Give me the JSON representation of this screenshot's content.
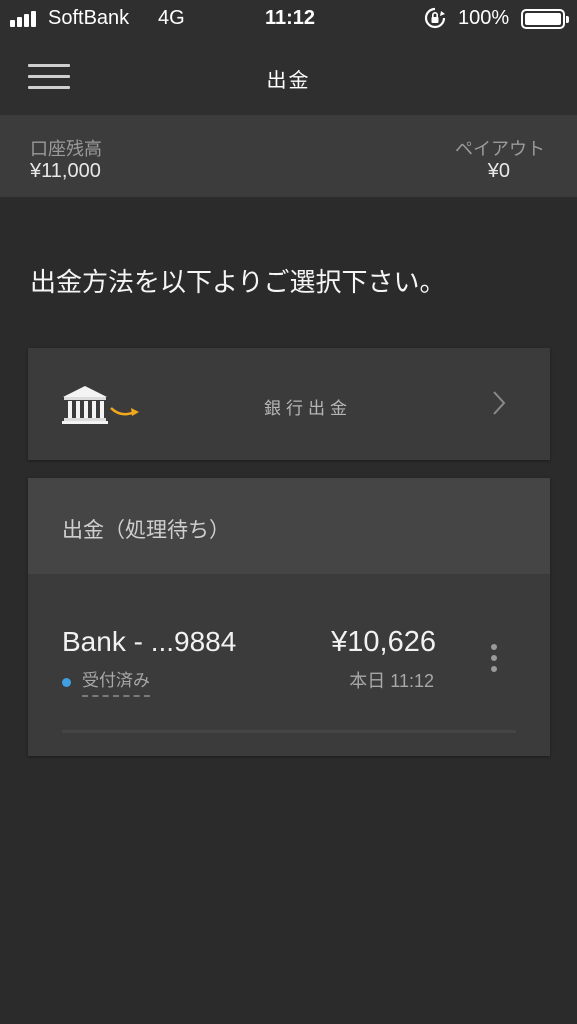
{
  "status_bar": {
    "carrier": "SoftBank",
    "network": "4G",
    "time": "11:12",
    "battery": "100%",
    "icons": [
      "signal-icon",
      "rotation-lock-icon",
      "battery-icon"
    ]
  },
  "header": {
    "title": "出金",
    "menu_icon": "hamburger-icon"
  },
  "balance": {
    "account_label": "口座残高",
    "account_value": "¥11,000",
    "payout_label": "ペイアウト",
    "payout_value": "¥0"
  },
  "instruction": "出金方法を以下よりご選択下さい。",
  "withdrawal_methods": [
    {
      "label": "銀行出金",
      "icon": "bank-icon"
    }
  ],
  "pending": {
    "title": "出金（処理待ち）",
    "items": [
      {
        "account": "Bank - ...9884",
        "amount": "¥10,626",
        "status": "受付済み",
        "time": "本日 11:12"
      }
    ]
  },
  "colors": {
    "background": "#2b2b2b",
    "card": "#3b3b3b",
    "status_dot": "#3f9fe0",
    "bank_arrow": "#f2a81d"
  }
}
